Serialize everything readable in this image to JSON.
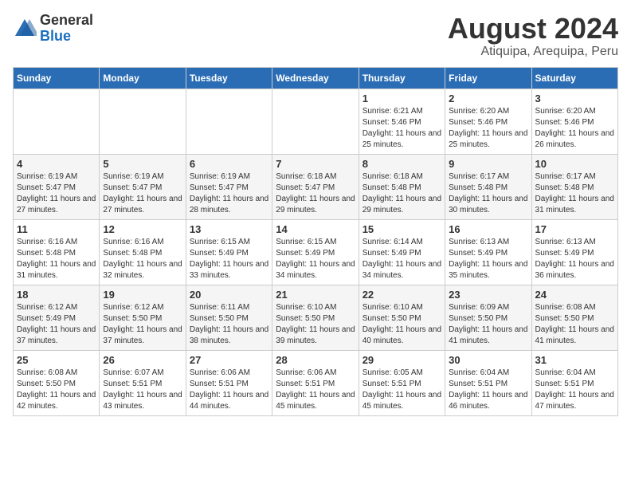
{
  "header": {
    "logo_general": "General",
    "logo_blue": "Blue",
    "title": "August 2024",
    "subtitle": "Atiquipa, Arequipa, Peru"
  },
  "days_of_week": [
    "Sunday",
    "Monday",
    "Tuesday",
    "Wednesday",
    "Thursday",
    "Friday",
    "Saturday"
  ],
  "weeks": [
    [
      {
        "day": "",
        "info": ""
      },
      {
        "day": "",
        "info": ""
      },
      {
        "day": "",
        "info": ""
      },
      {
        "day": "",
        "info": ""
      },
      {
        "day": "1",
        "info": "Sunrise: 6:21 AM\nSunset: 5:46 PM\nDaylight: 11 hours and 25 minutes."
      },
      {
        "day": "2",
        "info": "Sunrise: 6:20 AM\nSunset: 5:46 PM\nDaylight: 11 hours and 25 minutes."
      },
      {
        "day": "3",
        "info": "Sunrise: 6:20 AM\nSunset: 5:46 PM\nDaylight: 11 hours and 26 minutes."
      }
    ],
    [
      {
        "day": "4",
        "info": "Sunrise: 6:19 AM\nSunset: 5:47 PM\nDaylight: 11 hours and 27 minutes."
      },
      {
        "day": "5",
        "info": "Sunrise: 6:19 AM\nSunset: 5:47 PM\nDaylight: 11 hours and 27 minutes."
      },
      {
        "day": "6",
        "info": "Sunrise: 6:19 AM\nSunset: 5:47 PM\nDaylight: 11 hours and 28 minutes."
      },
      {
        "day": "7",
        "info": "Sunrise: 6:18 AM\nSunset: 5:47 PM\nDaylight: 11 hours and 29 minutes."
      },
      {
        "day": "8",
        "info": "Sunrise: 6:18 AM\nSunset: 5:48 PM\nDaylight: 11 hours and 29 minutes."
      },
      {
        "day": "9",
        "info": "Sunrise: 6:17 AM\nSunset: 5:48 PM\nDaylight: 11 hours and 30 minutes."
      },
      {
        "day": "10",
        "info": "Sunrise: 6:17 AM\nSunset: 5:48 PM\nDaylight: 11 hours and 31 minutes."
      }
    ],
    [
      {
        "day": "11",
        "info": "Sunrise: 6:16 AM\nSunset: 5:48 PM\nDaylight: 11 hours and 31 minutes."
      },
      {
        "day": "12",
        "info": "Sunrise: 6:16 AM\nSunset: 5:48 PM\nDaylight: 11 hours and 32 minutes."
      },
      {
        "day": "13",
        "info": "Sunrise: 6:15 AM\nSunset: 5:49 PM\nDaylight: 11 hours and 33 minutes."
      },
      {
        "day": "14",
        "info": "Sunrise: 6:15 AM\nSunset: 5:49 PM\nDaylight: 11 hours and 34 minutes."
      },
      {
        "day": "15",
        "info": "Sunrise: 6:14 AM\nSunset: 5:49 PM\nDaylight: 11 hours and 34 minutes."
      },
      {
        "day": "16",
        "info": "Sunrise: 6:13 AM\nSunset: 5:49 PM\nDaylight: 11 hours and 35 minutes."
      },
      {
        "day": "17",
        "info": "Sunrise: 6:13 AM\nSunset: 5:49 PM\nDaylight: 11 hours and 36 minutes."
      }
    ],
    [
      {
        "day": "18",
        "info": "Sunrise: 6:12 AM\nSunset: 5:49 PM\nDaylight: 11 hours and 37 minutes."
      },
      {
        "day": "19",
        "info": "Sunrise: 6:12 AM\nSunset: 5:50 PM\nDaylight: 11 hours and 37 minutes."
      },
      {
        "day": "20",
        "info": "Sunrise: 6:11 AM\nSunset: 5:50 PM\nDaylight: 11 hours and 38 minutes."
      },
      {
        "day": "21",
        "info": "Sunrise: 6:10 AM\nSunset: 5:50 PM\nDaylight: 11 hours and 39 minutes."
      },
      {
        "day": "22",
        "info": "Sunrise: 6:10 AM\nSunset: 5:50 PM\nDaylight: 11 hours and 40 minutes."
      },
      {
        "day": "23",
        "info": "Sunrise: 6:09 AM\nSunset: 5:50 PM\nDaylight: 11 hours and 41 minutes."
      },
      {
        "day": "24",
        "info": "Sunrise: 6:08 AM\nSunset: 5:50 PM\nDaylight: 11 hours and 41 minutes."
      }
    ],
    [
      {
        "day": "25",
        "info": "Sunrise: 6:08 AM\nSunset: 5:50 PM\nDaylight: 11 hours and 42 minutes."
      },
      {
        "day": "26",
        "info": "Sunrise: 6:07 AM\nSunset: 5:51 PM\nDaylight: 11 hours and 43 minutes."
      },
      {
        "day": "27",
        "info": "Sunrise: 6:06 AM\nSunset: 5:51 PM\nDaylight: 11 hours and 44 minutes."
      },
      {
        "day": "28",
        "info": "Sunrise: 6:06 AM\nSunset: 5:51 PM\nDaylight: 11 hours and 45 minutes."
      },
      {
        "day": "29",
        "info": "Sunrise: 6:05 AM\nSunset: 5:51 PM\nDaylight: 11 hours and 45 minutes."
      },
      {
        "day": "30",
        "info": "Sunrise: 6:04 AM\nSunset: 5:51 PM\nDaylight: 11 hours and 46 minutes."
      },
      {
        "day": "31",
        "info": "Sunrise: 6:04 AM\nSunset: 5:51 PM\nDaylight: 11 hours and 47 minutes."
      }
    ]
  ]
}
